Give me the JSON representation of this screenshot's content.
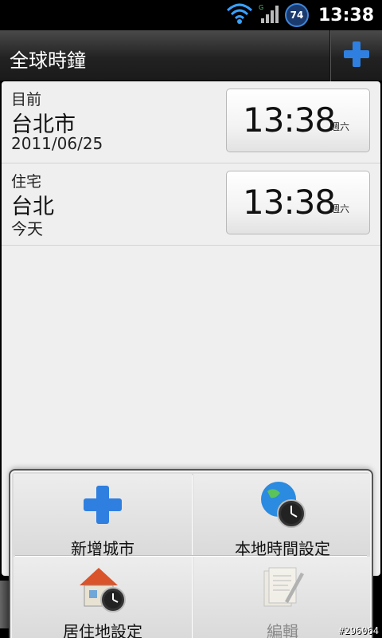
{
  "status_bar": {
    "time": "13:38",
    "battery_level": "74",
    "icons": [
      "wifi-icon",
      "signal-icon",
      "battery-icon"
    ]
  },
  "header": {
    "title": "全球時鐘",
    "add_button_icon": "plus-icon"
  },
  "cities": [
    {
      "label": "目前",
      "city": "台北市",
      "date": "2011/06/25",
      "time": "13:38",
      "day": "週六"
    },
    {
      "label": "住宅",
      "city": "台北",
      "date": "今天",
      "time": "13:38",
      "day": "週六"
    }
  ],
  "menu": {
    "items": [
      {
        "label": "新增城市",
        "icon": "plus-icon",
        "enabled": true
      },
      {
        "label": "本地時間設定",
        "icon": "globe-clock-icon",
        "enabled": true
      },
      {
        "label": "居住地設定",
        "icon": "home-clock-icon",
        "enabled": true
      },
      {
        "label": "編輯",
        "icon": "edit-document-icon",
        "enabled": false
      }
    ]
  },
  "watermark": "#296064",
  "colors": {
    "accent_blue": "#2f7fe0",
    "list_background": "#efefef",
    "title_bar": "#222222"
  }
}
